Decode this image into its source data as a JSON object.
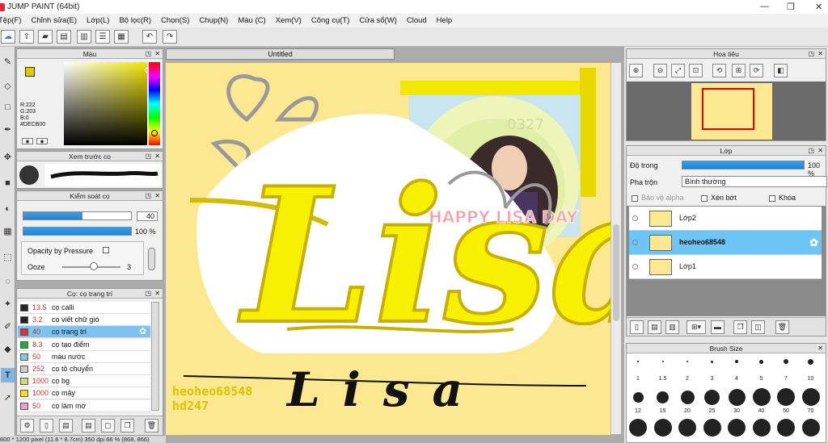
{
  "app": {
    "title": "JUMP PAINT (64bit)"
  },
  "menu": [
    "Tệp(F)",
    "Chỉnh sửa(E)",
    "Lớp(L)",
    "Bộ lọc(R)",
    "Chọn(S)",
    "Chụp(N)",
    "Màu (C)",
    "Xem(V)",
    "Công cụ(T)",
    "Cửa sổ(W)",
    "Cloud",
    "Help"
  ],
  "color_panel": {
    "title": "Màu",
    "r": "R:222",
    "g": "G:203",
    "b": "B:0",
    "hex": "#DECB00",
    "primary": "#DECB00",
    "secondary": "#ffffff"
  },
  "brush_preview": {
    "title": "Xem trước cọ"
  },
  "brush_control": {
    "title": "Kiểm soát cọ",
    "size": "40",
    "size_fill": 0.55,
    "opacity": "100 %",
    "opacity_fill": 1.0,
    "opacity_by_pressure": "Opacity by Pressure",
    "ooze_label": "Ooze",
    "ooze_value": "3",
    "ooze_fill": 0.3
  },
  "brush_list": {
    "title": "Cọ: cọ trang trí",
    "items": [
      {
        "num": "13.5",
        "name": "cọ calli",
        "color": "#222222"
      },
      {
        "num": "3.2",
        "name": "cọ viết chữ gió",
        "color": "#222222"
      },
      {
        "num": "40",
        "name": "cọ trang trí",
        "color": "#e03030",
        "selected": true
      },
      {
        "num": "8.3",
        "name": "cọ tạo điểm",
        "color": "#22aa33"
      },
      {
        "num": "50",
        "name": "màu nước",
        "color": "#7ec8f0"
      },
      {
        "num": "252",
        "name": "cọ tô chuyển",
        "color": "#cccccc"
      },
      {
        "num": "1000",
        "name": "cọ bg",
        "color": "#c8e070"
      },
      {
        "num": "1000",
        "name": "cọ mây",
        "color": "#f0e020"
      },
      {
        "num": "50",
        "name": "cọ làm mờ",
        "color": "#f0a0d0"
      }
    ]
  },
  "document": {
    "tab": "Untitled"
  },
  "canvas": {
    "main_text": "Lisa",
    "sub_text": "Lisa",
    "watermark1": "heoheo68548",
    "watermark2": "hd247",
    "photo_text": "HAPPY LISA DAY",
    "photo_number": "0327"
  },
  "navigator": {
    "title": "Hoa tiêu"
  },
  "layers": {
    "title": "Lớp",
    "opacity_label": "Độ trong",
    "opacity_value": "100 %",
    "blend_label": "Pha trộn",
    "blend_value": "Bình thường",
    "protect_alpha": "Bảo vệ alpha",
    "clip": "Xén bớt",
    "lock": "Khóa",
    "items": [
      {
        "name": "Lớp2"
      },
      {
        "name": "heoheo68548",
        "selected": true
      },
      {
        "name": "Lớp1"
      }
    ]
  },
  "brush_size": {
    "title": "Brush Size",
    "row1": [
      "1",
      "1.5",
      "2",
      "3",
      "4",
      "5",
      "7",
      "10"
    ],
    "row2": [
      "12",
      "15",
      "20",
      "25",
      "30",
      "40",
      "50",
      "70"
    ]
  },
  "status": {
    "text": "600 * 1200 pixel (11.6 * 8.7cm) 350 dpi 66 % (868, 866)"
  }
}
